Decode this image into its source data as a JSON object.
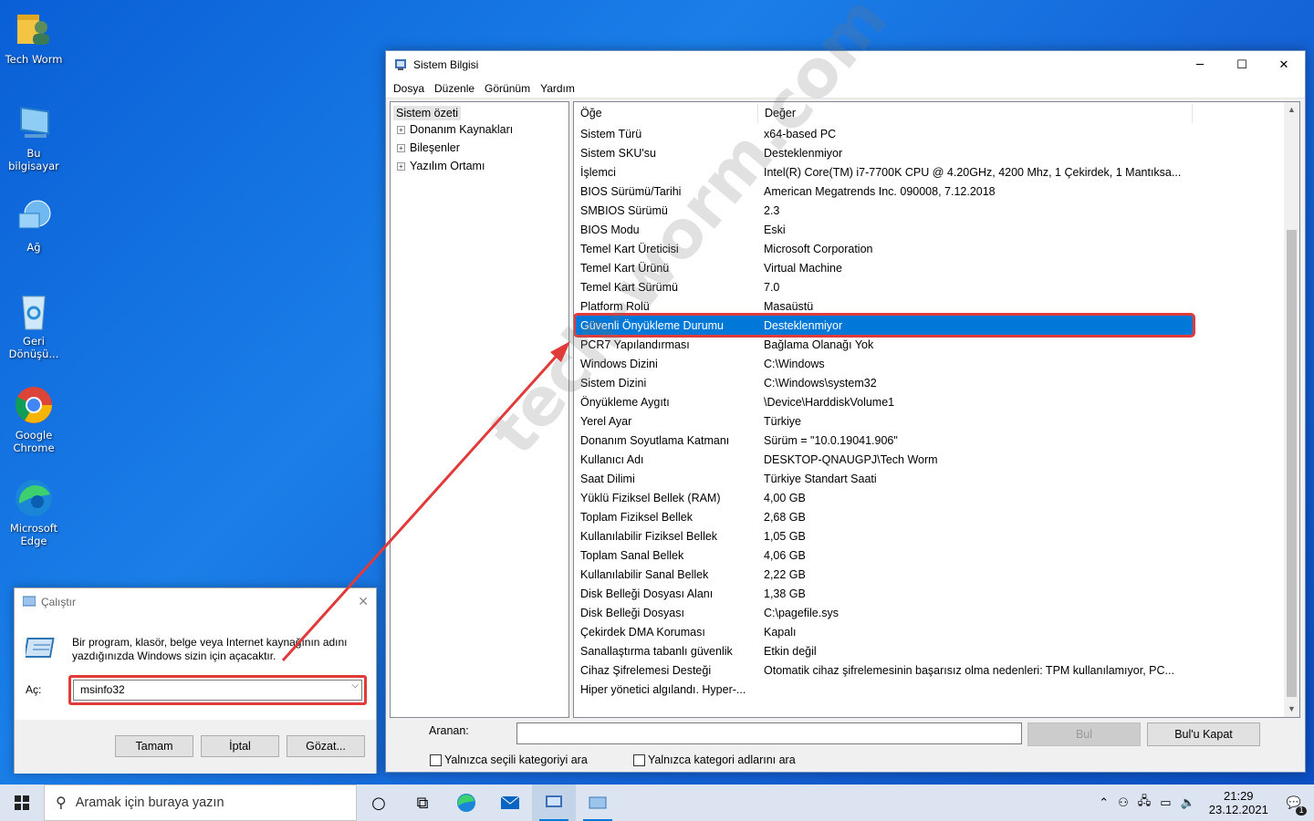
{
  "desktop": {
    "icons": [
      {
        "label": "Tech Worm",
        "icon": "user-folder-icon"
      },
      {
        "label": "Bu bilgisayar",
        "icon": "computer-icon"
      },
      {
        "label": "Ağ",
        "icon": "network-icon"
      },
      {
        "label": "Geri Dönüşü...",
        "icon": "recycle-bin-icon"
      },
      {
        "label": "Google Chrome",
        "icon": "chrome-icon"
      },
      {
        "label": "Microsoft Edge",
        "icon": "edge-icon"
      }
    ]
  },
  "window": {
    "title": "Sistem Bilgisi",
    "menu": [
      "Dosya",
      "Düzenle",
      "Görünüm",
      "Yardım"
    ],
    "tree": {
      "root": "Sistem özeti",
      "children": [
        "Donanım Kaynakları",
        "Bileşenler",
        "Yazılım Ortamı"
      ]
    },
    "columns": {
      "item": "Öğe",
      "value": "Değer"
    },
    "rows": [
      {
        "item": "Sistem Türü",
        "value": "x64-based PC"
      },
      {
        "item": "Sistem SKU'su",
        "value": "Desteklenmiyor"
      },
      {
        "item": "İşlemci",
        "value": "Intel(R) Core(TM) i7-7700K CPU @ 4.20GHz, 4200 Mhz, 1 Çekirdek, 1 Mantıksa..."
      },
      {
        "item": "BIOS Sürümü/Tarihi",
        "value": "American Megatrends Inc. 090008, 7.12.2018"
      },
      {
        "item": "SMBIOS Sürümü",
        "value": "2.3"
      },
      {
        "item": "BIOS Modu",
        "value": "Eski"
      },
      {
        "item": "Temel Kart Üreticisi",
        "value": "Microsoft Corporation"
      },
      {
        "item": "Temel Kart Ürünü",
        "value": "Virtual Machine"
      },
      {
        "item": "Temel Kart Sürümü",
        "value": "7.0"
      },
      {
        "item": "Platform Rolü",
        "value": "Masaüstü"
      },
      {
        "item": "Güvenli Önyükleme Durumu",
        "value": "Desteklenmiyor"
      },
      {
        "item": "PCR7 Yapılandırması",
        "value": "Bağlama Olanağı Yok"
      },
      {
        "item": "Windows Dizini",
        "value": "C:\\Windows"
      },
      {
        "item": "Sistem Dizini",
        "value": "C:\\Windows\\system32"
      },
      {
        "item": "Önyükleme Aygıtı",
        "value": "\\Device\\HarddiskVolume1"
      },
      {
        "item": "Yerel Ayar",
        "value": "Türkiye"
      },
      {
        "item": "Donanım Soyutlama Katmanı",
        "value": "Sürüm = \"10.0.19041.906\""
      },
      {
        "item": "Kullanıcı Adı",
        "value": "DESKTOP-QNAUGPJ\\Tech Worm"
      },
      {
        "item": "Saat Dilimi",
        "value": "Türkiye Standart Saati"
      },
      {
        "item": "Yüklü Fiziksel Bellek (RAM)",
        "value": "4,00 GB"
      },
      {
        "item": "Toplam Fiziksel Bellek",
        "value": "2,68 GB"
      },
      {
        "item": "Kullanılabilir Fiziksel Bellek",
        "value": "1,05 GB"
      },
      {
        "item": "Toplam Sanal Bellek",
        "value": "4,06 GB"
      },
      {
        "item": "Kullanılabilir Sanal Bellek",
        "value": "2,22 GB"
      },
      {
        "item": "Disk Belleği Dosyası Alanı",
        "value": "1,38 GB"
      },
      {
        "item": "Disk Belleği Dosyası",
        "value": "C:\\pagefile.sys"
      },
      {
        "item": "Çekirdek DMA Koruması",
        "value": "Kapalı"
      },
      {
        "item": "Sanallaştırma tabanlı güvenlik",
        "value": "Etkin değil"
      },
      {
        "item": "Cihaz Şifrelemesi Desteği",
        "value": "Otomatik cihaz şifrelemesinin başarısız olma nedenleri: TPM kullanılamıyor, PC..."
      },
      {
        "item": "Hiper yönetici algılandı. Hyper-...",
        "value": ""
      }
    ],
    "selected_row": "Güvenli Önyükleme Durumu",
    "find": {
      "label": "Aranan:",
      "value": "",
      "find_button": "Bul",
      "close_button": "Bul'u Kapat",
      "only_selected": "Yalnızca seçili kategoriyi ara",
      "only_names": "Yalnızca kategori adlarını ara"
    }
  },
  "run_dialog": {
    "title": "Çalıştır",
    "description": "Bir program, klasör, belge veya Internet kaynağının adını yazdığınızda Windows sizin için açacaktır.",
    "open_label": "Aç:",
    "value": "msinfo32",
    "ok": "Tamam",
    "cancel": "İptal",
    "browse": "Gözat..."
  },
  "taskbar": {
    "search_placeholder": "Aramak için buraya yazın",
    "time": "21:29",
    "date": "23.12.2021",
    "notification_count": "1"
  },
  "watermark": "tech-worm.com",
  "colors": {
    "selection": "#0078d7",
    "highlight": "#e03a3a",
    "arrow": "#e03a3a"
  }
}
